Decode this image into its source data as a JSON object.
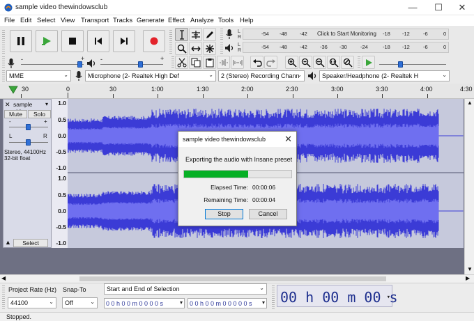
{
  "window": {
    "title": "sample video thewindowsclub",
    "minimize_glyph": "—",
    "maximize_glyph": "☐",
    "close_glyph": "✕"
  },
  "menu": {
    "items": [
      "File",
      "Edit",
      "Select",
      "View",
      "Transport",
      "Tracks",
      "Generate",
      "Effect",
      "Analyze",
      "Tools",
      "Help"
    ]
  },
  "meters": {
    "record_ticks": [
      "-54",
      "-48",
      "-42",
      "-18",
      "-12",
      "-6",
      "0"
    ],
    "record_message": "Click to Start Monitoring",
    "play_ticks": [
      "-54",
      "-48",
      "-42",
      "-36",
      "-30",
      "-24",
      "-18",
      "-12",
      "-6",
      "0"
    ],
    "channel_left": "L",
    "channel_right": "R"
  },
  "mixer": {
    "minus": "-",
    "plus": "+"
  },
  "devices": {
    "host": "MME",
    "recording_device": "Microphone (2- Realtek High Def",
    "channels": "2 (Stereo) Recording Chann",
    "playback_device": "Speaker/Headphone (2- Realtek H"
  },
  "timeline": {
    "labels": [
      "30",
      "0",
      "30",
      "1:00",
      "1:30",
      "2:00",
      "2:30",
      "3:00",
      "3:30",
      "4:00",
      "4:30"
    ]
  },
  "track": {
    "name": "sample video",
    "close_glyph": "✕",
    "mute_label": "Mute",
    "solo_label": "Solo",
    "pan_left": "L",
    "pan_right": "R",
    "info_line1": "Stereo, 44100Hz",
    "info_line2": "32-bit float",
    "select_label": "Select",
    "scale_labels": [
      "1.0",
      "0.5",
      "0.0",
      "-0.5",
      "-1.0",
      "1.0",
      "0.5",
      "0.0",
      "-0.5",
      "-1.0"
    ]
  },
  "colors": {
    "waveform": "#3b3bd6",
    "waveform_rms": "#6f6ff0",
    "track_bg": "#c6c9dc",
    "progress": "#06b025",
    "record": "#e3232b",
    "play": "#3aa63a"
  },
  "dialog": {
    "title": "sample video thewindowsclub",
    "close_glyph": "✕",
    "message": "Exporting the audio with Insane preset",
    "progress": 0.6,
    "elapsed_label": "Elapsed Time:",
    "elapsed_value": "00:00:06",
    "remaining_label": "Remaining Time:",
    "remaining_value": "00:00:04",
    "stop_label": "Stop",
    "cancel_label": "Cancel"
  },
  "selection": {
    "project_rate_label": "Project Rate (Hz)",
    "project_rate_value": "44100",
    "snap_to_label": "Snap-To",
    "snap_to_value": "Off",
    "selection_mode": "Start and End of Selection",
    "start_time": "0 0 h 0 0 m 0 0 0 0 s",
    "end_time": "0 0 h 0 0 m 0 0 0 0 0 s",
    "big_time": "00 h 00 m 00 s"
  },
  "status": {
    "text": "Stopped."
  }
}
